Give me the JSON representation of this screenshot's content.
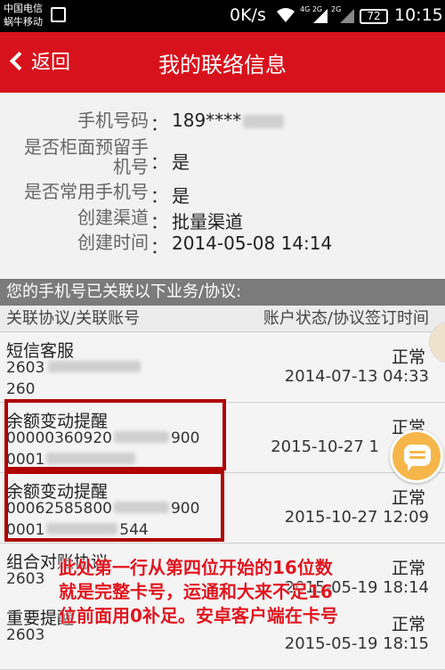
{
  "statusbar": {
    "carrier1": "中国电信",
    "carrier2": "蜗牛移动",
    "speed": "0K/s",
    "signal1": "4G 2G",
    "signal2": "2G",
    "battery": "72",
    "time": "10:15"
  },
  "header": {
    "back_label": "返回",
    "title": "我的联络信息"
  },
  "info": {
    "rows": [
      {
        "label": "手机号码",
        "colon": "：",
        "value": "189****"
      },
      {
        "label": "是否柜面预留手",
        "label2": "机号",
        "colon": "：",
        "value": "是"
      },
      {
        "label": "是否常用手机号",
        "colon": "：",
        "value": "是"
      },
      {
        "label": "创建渠道",
        "colon": "：",
        "value": "批量渠道"
      },
      {
        "label": "创建时间",
        "colon": "：",
        "value": "2014-05-08 14:14"
      }
    ]
  },
  "section": {
    "header": "您的手机号已关联以下业务/协议:",
    "col_left": "关联协议/关联账号",
    "col_right": "账户状态/协议签订时间"
  },
  "items": [
    {
      "name": "短信客服",
      "acct1": "2603",
      "acct2": "260",
      "status": "正常",
      "date": "2014-07-13 04:33"
    },
    {
      "name": "余额变动提醒",
      "acct1": "00000360920",
      "acct1_tail": "900",
      "acct2": "0001",
      "status": "正常",
      "date": "2015-10-27 1"
    },
    {
      "name": "余额变动提醒",
      "acct1": "00062585800",
      "acct1_tail": "900",
      "acct2": "0001",
      "acct2_tail": "544",
      "status": "正常",
      "date": "2015-10-27 12:09"
    },
    {
      "name": "组合对账协议",
      "acct1": "2603",
      "status": "正常",
      "date": "2015-05-19 18:14"
    },
    {
      "name": "重要提醒",
      "acct1": "2603",
      "status": "正常",
      "date": "2015-05-19 18:15"
    }
  ],
  "overlay_note": {
    "line1": "此处第一行从第四位开始的16位数",
    "line2": "就是完整卡号，运通和大来不足16",
    "line3": "位前面用0补足。安卓客户端在卡号"
  },
  "colors": {
    "header_bg": "#d8121c",
    "section_bg": "#7b7b7b",
    "highlight_box": "#b00000",
    "note_text": "#e0151f"
  },
  "icons": [
    "back-chevron-icon",
    "wifi-icon",
    "signal-icon",
    "battery-icon",
    "image-icon",
    "chat-icon"
  ]
}
